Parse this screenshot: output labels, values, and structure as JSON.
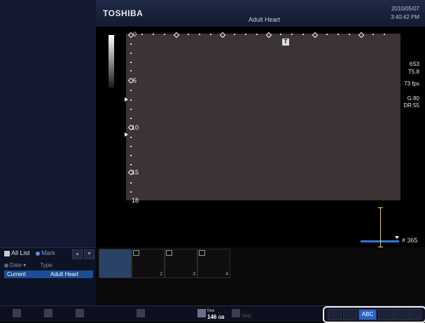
{
  "header": {
    "brand": "TOSHIBA",
    "preset": "Adult Heart",
    "date": "2010/05/07",
    "time": "3:40:42 PM"
  },
  "depth_labels": [
    "0",
    "5",
    "10",
    "15",
    "18"
  ],
  "probe_mark": "T",
  "params": {
    "probe": "6S3",
    "ti": "T5.8",
    "fps": "73 fps",
    "gain": "G:80",
    "dr": "DR:55"
  },
  "cine": {
    "frame_count": "# 365"
  },
  "study_list": {
    "all_list": "All List",
    "mark": "Mark",
    "col_date": "Date",
    "col_type": "Type",
    "row_date": "Current",
    "row_type": "Adult Heart"
  },
  "thumbnails": [
    "2",
    "3",
    "4"
  ],
  "storage": {
    "free_label": "free",
    "free_value": "146",
    "free_unit": "GB",
    "disk": "DVD"
  },
  "toolbar": {
    "abc_label": "ABC"
  }
}
